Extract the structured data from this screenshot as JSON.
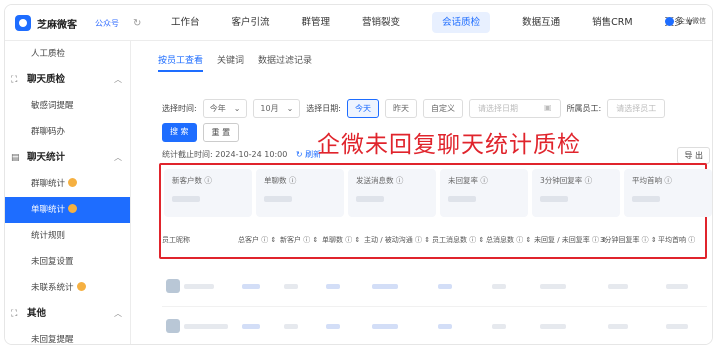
{
  "brand": {
    "name": "芝麻微客",
    "tag": "公众号",
    "refresh_icon": "refresh-icon"
  },
  "nav": {
    "items": [
      "工作台",
      "客户引流",
      "群管理",
      "营销裂变",
      "会话质检",
      "数据互通",
      "销售CRM",
      "更多 ∨"
    ],
    "active": "会话质检",
    "company": "企业微信"
  },
  "sidebar": {
    "items": [
      {
        "type": "item",
        "label": "人工质检"
      },
      {
        "type": "group",
        "label": "聊天质检",
        "icon": "chat-icon"
      },
      {
        "type": "item",
        "label": "敏感词提醒"
      },
      {
        "type": "item",
        "label": "群聊码办"
      },
      {
        "type": "group",
        "label": "聊天统计",
        "icon": "stats-icon"
      },
      {
        "type": "item",
        "label": "群聊统计",
        "badge": true
      },
      {
        "type": "item",
        "label": "单聊统计",
        "badge": true,
        "active": true
      },
      {
        "type": "item",
        "label": "统计规则"
      },
      {
        "type": "item",
        "label": "未回复设置"
      },
      {
        "type": "item",
        "label": "未联系统计",
        "badge": true
      },
      {
        "type": "group",
        "label": "其他",
        "icon": "other-icon"
      },
      {
        "type": "item",
        "label": "未回复提醒"
      }
    ]
  },
  "tabs": [
    "按员工查看",
    "关键词",
    "数据过滤记录"
  ],
  "filters": {
    "time_label": "选择时间:",
    "year": "今年",
    "month": "10月",
    "date_label": "选择日期:",
    "today": "今天",
    "yesterday": "昨天",
    "custom": "自定义",
    "date_placeholder": "请选择日期",
    "staff_label": "所属员工:",
    "staff_placeholder": "请选择员工"
  },
  "buttons": {
    "search": "搜 索",
    "reset": "重 置",
    "export": "导 出"
  },
  "stat_time": {
    "label": "统计截止时间: 2024-10-24 10:00",
    "refresh": "刷新"
  },
  "cards": [
    "新客户数 ⓘ",
    "单聊数 ⓘ",
    "发送消息数 ⓘ",
    "未回复率 ⓘ",
    "3分钟回复率 ⓘ",
    "平均首响 ⓘ"
  ],
  "table_headers": [
    "员工昵称",
    "总客户 ⓘ ⇕",
    "新客户 ⓘ ⇕",
    "单聊数 ⓘ ⇕",
    "主动 / 被动沟通 ⓘ ⇕",
    "员工消息数 ⓘ ⇕",
    "总消息数 ⓘ ⇕",
    "未回复 / 未回复率 ⓘ ⇕",
    "3分钟回复率 ⓘ ⇕",
    "平均首响 ⓘ"
  ],
  "caption": "企微未回复聊天统计质检",
  "colors": {
    "accent": "#1e6dff",
    "highlight": "#e0242c"
  }
}
